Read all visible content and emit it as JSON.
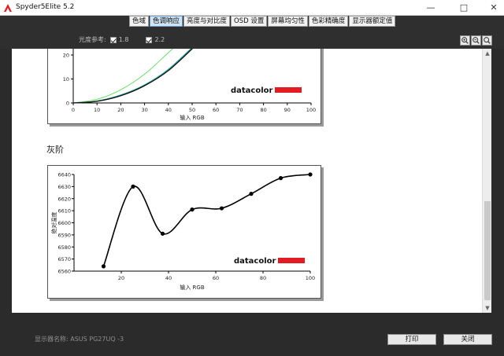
{
  "window": {
    "title": "Spyder5Elite 5.2",
    "minimize_glyph": "—",
    "maximize_glyph": "□",
    "close_glyph": "✕"
  },
  "tabs": [
    {
      "label": "色域",
      "active": false
    },
    {
      "label": "色调响应",
      "active": true
    },
    {
      "label": "亮度与对比度",
      "active": false
    },
    {
      "label": "OSD 设置",
      "active": false
    },
    {
      "label": "屏幕均匀性",
      "active": false
    },
    {
      "label": "色彩精确度",
      "active": false
    },
    {
      "label": "显示器额定值",
      "active": false
    }
  ],
  "gamma_reference": {
    "label": "光度参考:",
    "option_1": "1.8",
    "option_2": "2.2"
  },
  "zoom_icons": [
    "zoom-in-icon",
    "zoom-out-icon",
    "zoom-fit-icon"
  ],
  "section": {
    "grayscale_title": "灰阶"
  },
  "chart_data": [
    {
      "type": "line",
      "partial": true,
      "xlabel": "输入 RGB",
      "x_ticks": [
        "0",
        "10",
        "20",
        "30",
        "40",
        "50",
        "60",
        "70",
        "80",
        "90",
        "100"
      ],
      "y_ticks": [
        "20",
        "10",
        "0"
      ],
      "xlim": [
        0,
        100
      ],
      "series": [
        {
          "x": [
            0,
            10,
            20,
            30,
            40,
            52
          ],
          "y": [
            0,
            1.5,
            5.5,
            12,
            21,
            32
          ],
          "color": "#66dd66"
        },
        {
          "x": [
            0,
            10,
            20,
            30,
            40,
            52
          ],
          "y": [
            0,
            0.8,
            3.3,
            7.5,
            14,
            25
          ],
          "color": "#2aa6a6"
        },
        {
          "x": [
            0,
            10,
            20,
            30,
            40,
            52
          ],
          "y": [
            0,
            0.7,
            3.0,
            7.2,
            13.5,
            24.5
          ],
          "color": "#111111"
        }
      ],
      "watermark": "datacolor"
    },
    {
      "type": "line",
      "ylabel": "绝对温度",
      "xlabel": "输入 RGB",
      "x_ticks": [
        "20",
        "40",
        "60",
        "80",
        "100"
      ],
      "y_ticks": [
        "6640",
        "6630",
        "6620",
        "6610",
        "6600",
        "6590",
        "6580",
        "6570",
        "6560"
      ],
      "xlim": [
        0,
        100
      ],
      "ylim": [
        6560,
        6640
      ],
      "series": [
        {
          "x": [
            12.5,
            25,
            37.5,
            50,
            62.5,
            75,
            87.5,
            100
          ],
          "y": [
            6564,
            6630,
            6591,
            6611,
            6612,
            6624,
            6637,
            6640
          ],
          "color": "#000000"
        }
      ],
      "watermark": "datacolor"
    }
  ],
  "footer": {
    "monitor_name": "显示器名称: ASUS PG27UQ -3",
    "print_label": "打印",
    "close_label": "关闭"
  },
  "colors": {
    "accent_tab": "#cfe3f5",
    "datacolor_red": "#e31b23",
    "background_dark": "#2b2b2b"
  }
}
